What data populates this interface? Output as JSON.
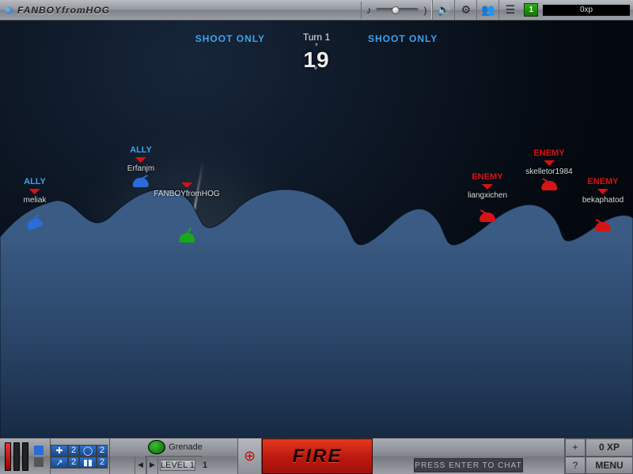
{
  "topbar": {
    "title": "FANBOYfromHOG",
    "level": "1",
    "xp_text": "0xp"
  },
  "turn": {
    "left_mode": "SHOOT ONLY",
    "right_mode": "SHOOT ONLY",
    "label": "Turn 1",
    "timer": "19"
  },
  "units": {
    "meliak": {
      "role": "ALLY",
      "name": "meliak",
      "color": "blue"
    },
    "erfanjm": {
      "role": "ALLY",
      "name": "Erfanjm",
      "color": "blue"
    },
    "fanboy": {
      "role": "",
      "name": "FANBOYfromHOG",
      "color": "green"
    },
    "liangxichen": {
      "role": "ENEMY",
      "name": "liangxichen",
      "color": "red"
    },
    "skelletor1984": {
      "role": "ENEMY",
      "name": "skelletor1984",
      "color": "red"
    },
    "bekaphatod": {
      "role": "ENEMY",
      "name": "bekaphatod",
      "color": "red"
    }
  },
  "weapon": {
    "name": "Grenade",
    "level_label": "LEVEL 1",
    "count": "1"
  },
  "bluegrid": {
    "a": "2",
    "b": "2",
    "c": "2"
  },
  "fire_label": "FIRE",
  "chat_placeholder": "PRESS ENTER TO CHAT",
  "right": {
    "plus": "+",
    "xp": "0 XP",
    "q": "?",
    "menu": "MENU"
  },
  "icons": {
    "music": "♪",
    "music2": ")",
    "sound": "🔊",
    "gear": "⚙",
    "friends": "👥",
    "list": "☰",
    "target": "⊕"
  }
}
